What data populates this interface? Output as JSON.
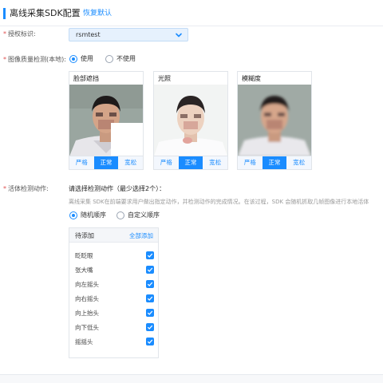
{
  "header": {
    "title": "离线采集SDK配置",
    "restore_link": "恢复默认"
  },
  "auth": {
    "label": "授权标识:",
    "value": "rsmtest",
    "arrow_icon": "chevron-down-icon"
  },
  "quality": {
    "label": "图像质量检测(本地):",
    "options": [
      {
        "label": "使用",
        "selected": true
      },
      {
        "label": "不使用",
        "selected": false
      }
    ],
    "cards": [
      {
        "title": "脸部遮挡",
        "buttons": [
          "严格",
          "正常",
          "宽松"
        ],
        "active": "正常",
        "variant": "occlusion"
      },
      {
        "title": "光照",
        "buttons": [
          "严格",
          "正常",
          "宽松"
        ],
        "active": "正常",
        "variant": "lighting"
      },
      {
        "title": "模糊度",
        "buttons": [
          "严格",
          "正常",
          "宽松"
        ],
        "active": "正常",
        "variant": "blur"
      }
    ]
  },
  "liveness": {
    "label": "活体检测动作:",
    "subtitle": "请选择检测动作（最少选择2个）：",
    "description": "离线采集 SDK在前端要求用户做出指定动作，并检测动作的完成情况。在该过程，SDK 会随机抓取几帧图像进行本地活体",
    "order_options": [
      {
        "label": "随机顺序",
        "selected": true
      },
      {
        "label": "自定义顺序",
        "selected": false
      }
    ],
    "list": {
      "header": "待添加",
      "add_all": "全部添加",
      "items": [
        {
          "label": "眨眨眼",
          "checked": true
        },
        {
          "label": "张大嘴",
          "checked": true
        },
        {
          "label": "向左摇头",
          "checked": true
        },
        {
          "label": "向右摇头",
          "checked": true
        },
        {
          "label": "向上抬头",
          "checked": true
        },
        {
          "label": "向下低头",
          "checked": true
        },
        {
          "label": "摇摇头",
          "checked": true
        }
      ]
    }
  },
  "colors": {
    "accent": "#1a8cff",
    "required_star": "#e05050"
  }
}
